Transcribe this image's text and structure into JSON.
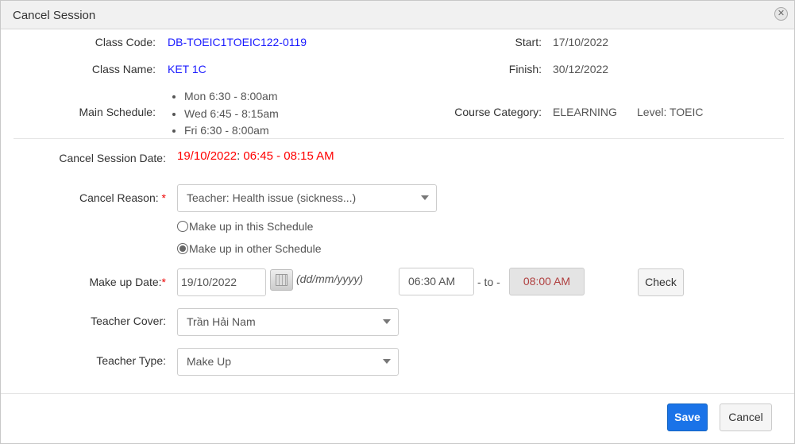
{
  "title": "Cancel Session",
  "info": {
    "class_code_label": "Class Code:",
    "class_code": "DB-TOEIC1TOEIC122-0119",
    "class_name_label": "Class Name:",
    "class_name": "KET 1C",
    "main_schedule_label": "Main Schedule:",
    "schedule": [
      "Mon 6:30 - 8:00am",
      "Wed 6:45 - 8:15am",
      "Fri 6:30 - 8:00am"
    ],
    "start_label": "Start:",
    "start": "17/10/2022",
    "finish_label": "Finish:",
    "finish": "30/12/2022",
    "category_label": "Course Category:",
    "category": "ELEARNING",
    "level": "Level: TOEIC"
  },
  "form": {
    "cancel_date_label": "Cancel Session Date:",
    "cancel_date": "19/10/2022",
    "cancel_colon": ":",
    "cancel_time": " 06:45 - 08:15 AM",
    "reason_label": "Cancel Reason:",
    "required": "*",
    "reason": "Teacher: Health issue (sickness...)",
    "radio1": "Make up in this Schedule",
    "radio2": "Make up in other Schedule",
    "makeup_label": "Make up Date:",
    "makeup_date": "19/10/2022",
    "date_hint": "(dd/mm/yyyy)",
    "time_from": "06:30 AM",
    "to": "- to -",
    "time_to": "08:00 AM",
    "check": "Check",
    "teacher_cover_label": "Teacher Cover:",
    "teacher_cover": "Trần Hải Nam",
    "teacher_type_label": "Teacher Type:",
    "teacher_type": "Make Up"
  },
  "footer": {
    "save": "Save",
    "cancel": "Cancel"
  }
}
